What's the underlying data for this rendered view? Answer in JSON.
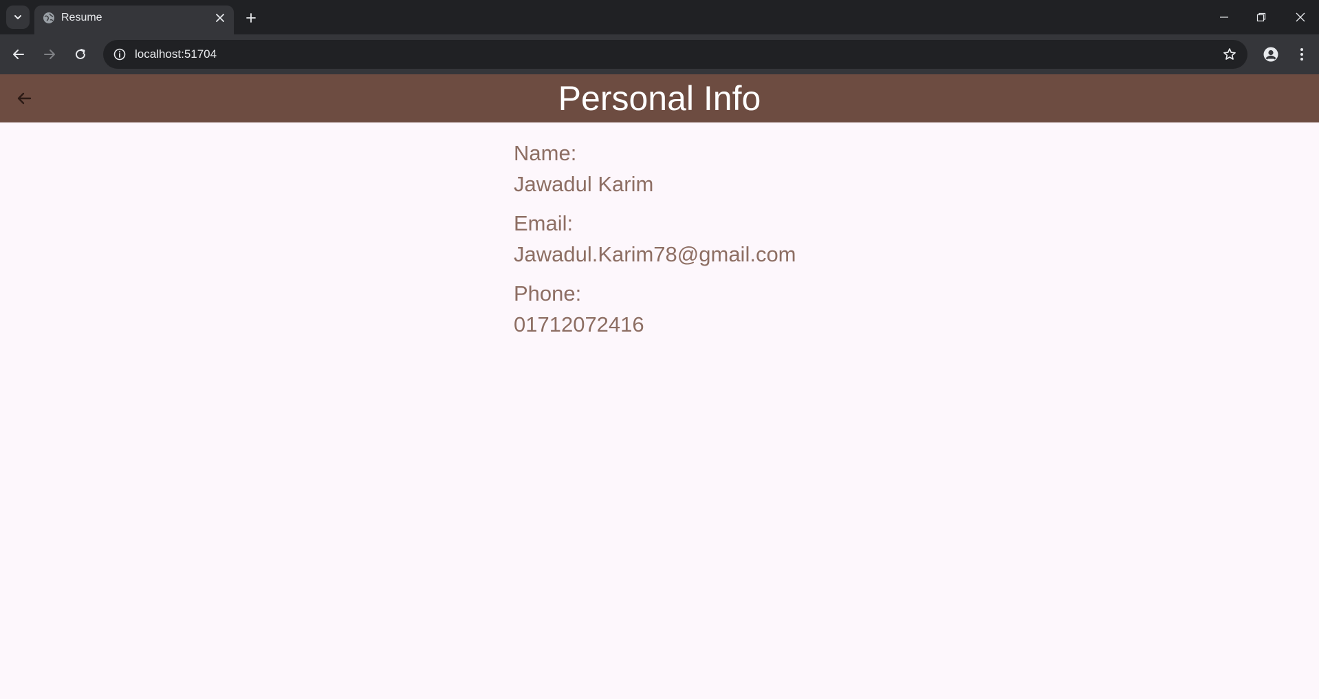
{
  "browser": {
    "tab_title": "Resume",
    "url": "localhost:51704"
  },
  "appbar": {
    "title": "Personal Info",
    "color": "#6d4c41"
  },
  "fields": [
    {
      "label": "Name:",
      "value": "Jawadul Karim"
    },
    {
      "label": "Email:",
      "value": "Jawadul.Karim78@gmail.com"
    },
    {
      "label": "Phone:",
      "value": "01712072416"
    }
  ],
  "colors": {
    "background": "#fdf7fc",
    "text": "#8d6e63"
  },
  "icons": {
    "tab_search": "chevron-down-icon",
    "favicon": "globe-icon",
    "tab_close": "close-icon",
    "new_tab": "plus-icon",
    "back": "arrow-left-icon",
    "forward": "arrow-right-icon",
    "reload": "reload-icon",
    "site_info": "info-icon",
    "bookmark": "star-icon",
    "profile": "profile-icon",
    "menu": "kebab-menu-icon",
    "minimize": "minimize-icon",
    "restore": "restore-icon",
    "close_window": "close-icon",
    "appbar_back": "arrow-left-icon"
  }
}
